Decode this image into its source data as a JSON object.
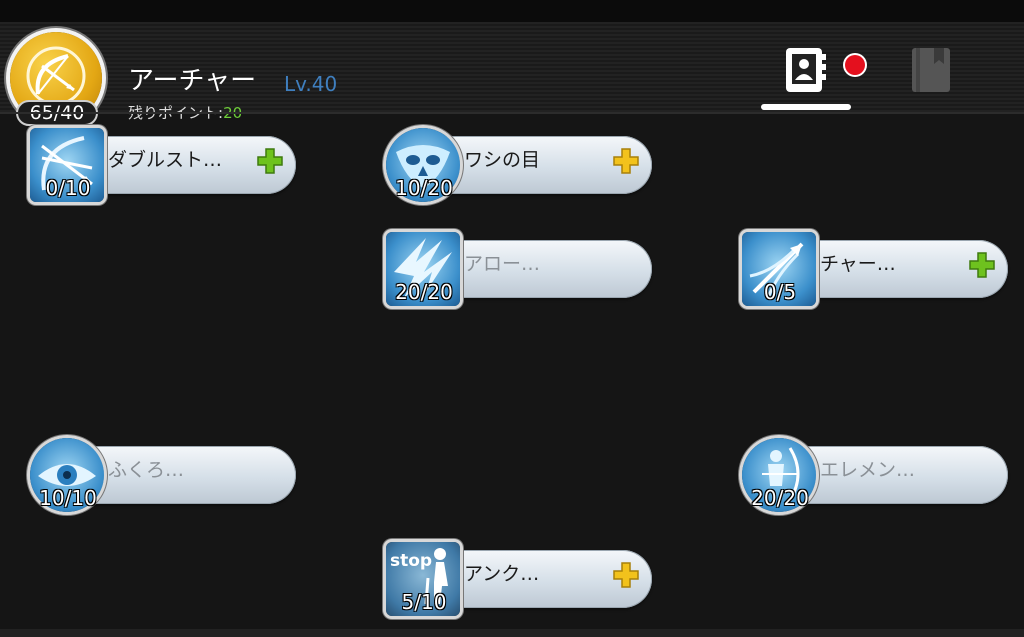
{
  "header": {
    "class_name": "アーチャー",
    "level": "Lv.40",
    "points": "65/40",
    "remaining_label": "残りポイント:",
    "remaining_value": "20",
    "class_icon": "bow-icon",
    "tabs": [
      {
        "icon": "skill-book-profile-icon",
        "active": true,
        "notification": true
      },
      {
        "icon": "bookmark-book-icon",
        "active": false,
        "notification": false
      }
    ]
  },
  "skills": [
    {
      "name": "ダブルスト…",
      "level": "0/10",
      "icon": "double-arrow-bow-icon",
      "plus": "green",
      "locked": false
    },
    {
      "name": "ワシの目",
      "level": "10/20",
      "icon": "eagle-eye-icon",
      "plus": "yellow",
      "locked": false
    },
    {
      "name": "アロー…",
      "level": "20/20",
      "icon": "arrow-rain-icon",
      "plus": "none",
      "locked": true
    },
    {
      "name": "チャー…",
      "level": "0/5",
      "icon": "charge-shot-icon",
      "plus": "green",
      "locked": false
    },
    {
      "name": "ふくろ…",
      "level": "10/10",
      "icon": "owl-eye-icon",
      "plus": "none",
      "locked": true
    },
    {
      "name": "エレメン…",
      "level": "20/20",
      "icon": "elemental-archer-icon",
      "plus": "none",
      "locked": true
    },
    {
      "name": "アンク…",
      "level": "5/10",
      "icon": "ankle-stop-icon",
      "icon_text": "stop",
      "plus": "yellow",
      "locked": false
    }
  ],
  "colors": {
    "background": "#151515",
    "level_text": "#3f7fbf",
    "remaining_value": "#6fcf3a",
    "plus_green": "#6ec21e",
    "plus_yellow": "#f2c21c",
    "notification": "#e4101e"
  }
}
